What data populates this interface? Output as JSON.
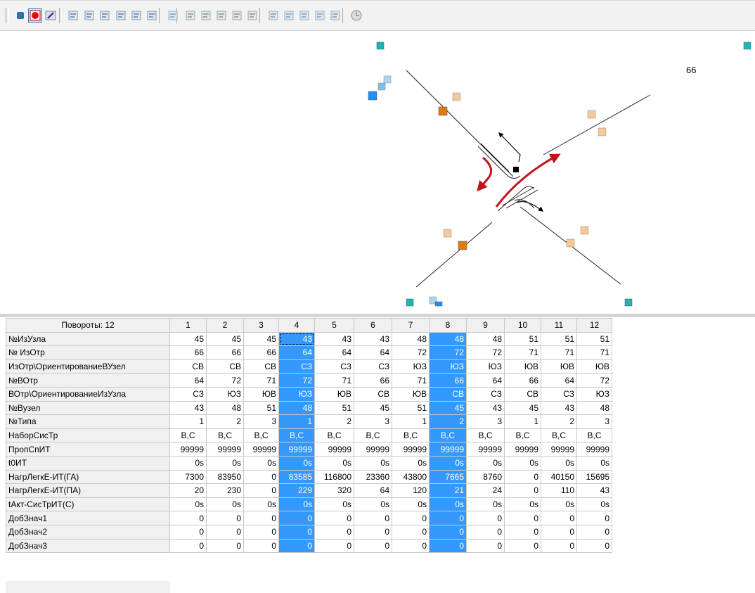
{
  "toolbar": {
    "icons": [
      "stop-icon",
      "record-icon",
      "edit-icon",
      "los-path-icon",
      "los-table-icon",
      "los-cycle-icon",
      "los-small-icon",
      "los-warning-icon",
      "los-arrow-icon",
      "map-icon",
      "insert-icon",
      "edit-doc-icon",
      "delete-doc-icon",
      "export-doc-icon",
      "copy-doc-icon",
      "list-icon",
      "grid-icon",
      "table-icon",
      "table-add-icon",
      "table-remove-icon",
      "clock-icon"
    ]
  },
  "canvas": {
    "node_label": "66"
  },
  "grid": {
    "corner": "Повороты: 12",
    "columns": [
      "1",
      "2",
      "3",
      "4",
      "5",
      "6",
      "7",
      "8",
      "9",
      "10",
      "11",
      "12"
    ],
    "selected_columns": [
      3,
      7
    ],
    "focused_cell": {
      "row": 0,
      "col": 3
    },
    "rows": [
      {
        "label": "№ИзУзла",
        "values": [
          "45",
          "45",
          "45",
          "43",
          "43",
          "43",
          "48",
          "48",
          "48",
          "51",
          "51",
          "51"
        ]
      },
      {
        "label": "№ ИзОтр",
        "values": [
          "66",
          "66",
          "66",
          "64",
          "64",
          "64",
          "72",
          "72",
          "72",
          "71",
          "71",
          "71"
        ]
      },
      {
        "label": "ИзОтр\\ОриентированиеВУзел",
        "values": [
          "СВ",
          "СВ",
          "СВ",
          "СЗ",
          "СЗ",
          "СЗ",
          "ЮЗ",
          "ЮЗ",
          "ЮЗ",
          "ЮВ",
          "ЮВ",
          "ЮВ"
        ]
      },
      {
        "label": "№ВОтр",
        "values": [
          "64",
          "72",
          "71",
          "72",
          "71",
          "66",
          "71",
          "66",
          "64",
          "66",
          "64",
          "72"
        ]
      },
      {
        "label": "ВОтр\\ОриентированиеИзУзла",
        "values": [
          "СЗ",
          "ЮЗ",
          "ЮВ",
          "ЮЗ",
          "ЮВ",
          "СВ",
          "ЮВ",
          "СВ",
          "СЗ",
          "СВ",
          "СЗ",
          "ЮЗ"
        ]
      },
      {
        "label": "№Вузел",
        "values": [
          "43",
          "48",
          "51",
          "48",
          "51",
          "45",
          "51",
          "45",
          "43",
          "45",
          "43",
          "48"
        ]
      },
      {
        "label": "№Типа",
        "values": [
          "1",
          "2",
          "3",
          "1",
          "2",
          "3",
          "1",
          "2",
          "3",
          "1",
          "2",
          "3"
        ]
      },
      {
        "label": "НаборСисТр",
        "values": [
          "В,С",
          "В,С",
          "В,С",
          "В,С",
          "В,С",
          "В,С",
          "В,С",
          "В,С",
          "В,С",
          "В,С",
          "В,С",
          "В,С"
        ],
        "center": true
      },
      {
        "label": "ПропСпИТ",
        "values": [
          "99999",
          "99999",
          "99999",
          "99999",
          "99999",
          "99999",
          "99999",
          "99999",
          "99999",
          "99999",
          "99999",
          "99999"
        ]
      },
      {
        "label": "t0ИТ",
        "values": [
          "0s",
          "0s",
          "0s",
          "0s",
          "0s",
          "0s",
          "0s",
          "0s",
          "0s",
          "0s",
          "0s",
          "0s"
        ]
      },
      {
        "label": "НагрЛегкЕ-ИТ(ГА)",
        "values": [
          "7300",
          "83950",
          "0",
          "83585",
          "116800",
          "23360",
          "43800",
          "7665",
          "8760",
          "0",
          "40150",
          "15695"
        ]
      },
      {
        "label": "НагрЛегкЕ-ИТ(ПА)",
        "values": [
          "20",
          "230",
          "0",
          "229",
          "320",
          "64",
          "120",
          "21",
          "24",
          "0",
          "110",
          "43"
        ]
      },
      {
        "label": "tАкт-СисТрИТ(С)",
        "values": [
          "0s",
          "0s",
          "0s",
          "0s",
          "0s",
          "0s",
          "0s",
          "0s",
          "0s",
          "0s",
          "0s",
          "0s"
        ]
      },
      {
        "label": "ДобЗнач1",
        "values": [
          "0",
          "0",
          "0",
          "0",
          "0",
          "0",
          "0",
          "0",
          "0",
          "0",
          "0",
          "0"
        ]
      },
      {
        "label": "ДобЗнач2",
        "values": [
          "0",
          "0",
          "0",
          "0",
          "0",
          "0",
          "0",
          "0",
          "0",
          "0",
          "0",
          "0"
        ]
      },
      {
        "label": "ДобЗнач3",
        "values": [
          "0",
          "0",
          "0",
          "0",
          "0",
          "0",
          "0",
          "0",
          "0",
          "0",
          "0",
          "0"
        ]
      }
    ]
  },
  "colors": {
    "selection": "#3399ff",
    "turn_arrow": "#c0141a",
    "node_teal": "#1fb5b0",
    "marker_orange": "#e07a10",
    "marker_peach": "#f5c99a"
  }
}
